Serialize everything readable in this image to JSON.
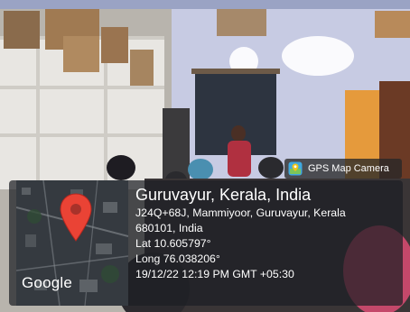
{
  "camera_chip": {
    "label": "GPS Map Camera",
    "icon": "gps-map-camera-icon"
  },
  "map": {
    "logo_text": "Google",
    "pin_color": "#ea4335"
  },
  "location": {
    "place": "Guruvayur, Kerala, India",
    "address_line_1": "J24Q+68J, Mammiyoor, Guruvayur, Kerala",
    "address_line_2": "680101, India",
    "latitude": "Lat 10.605797°",
    "longitude": "Long 76.038206°",
    "timestamp": "19/12/22 12:19 PM GMT +05:30"
  }
}
